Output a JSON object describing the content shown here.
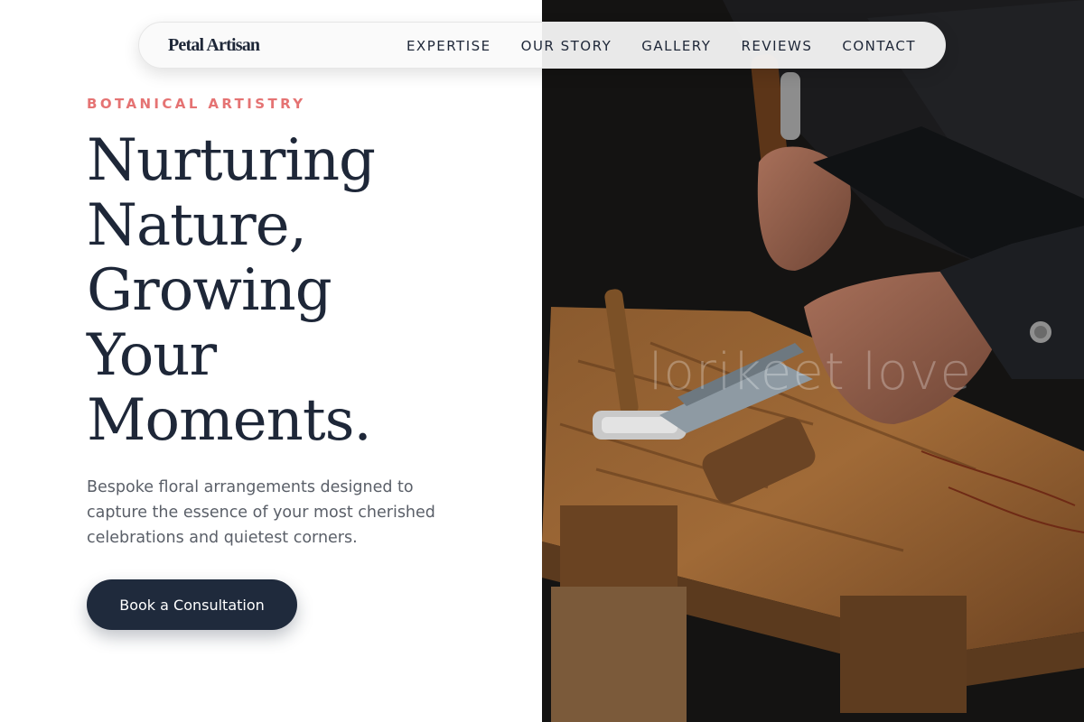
{
  "nav": {
    "brand": "Petal Artisan",
    "links": [
      "EXPERTISE",
      "OUR STORY",
      "GALLERY",
      "REVIEWS",
      "CONTACT"
    ]
  },
  "hero": {
    "eyebrow": "BOTANICAL ARTISTRY",
    "headline_lines": [
      "Nurturing",
      "Nature,",
      "Growing",
      "Your",
      "Moments."
    ],
    "subtext": "Bespoke floral arrangements designed to capture the essence of your most cherished celebrations and quietest corners.",
    "cta_label": "Book a Consultation"
  },
  "photo": {
    "watermark": "lorikeet love",
    "subject": "craftsman-hands-with-hammers-on-workbench"
  },
  "colors": {
    "accent": "#e57373",
    "navy": "#1e2738",
    "button": "#1f2a3c",
    "body_text": "#5a5f68"
  }
}
